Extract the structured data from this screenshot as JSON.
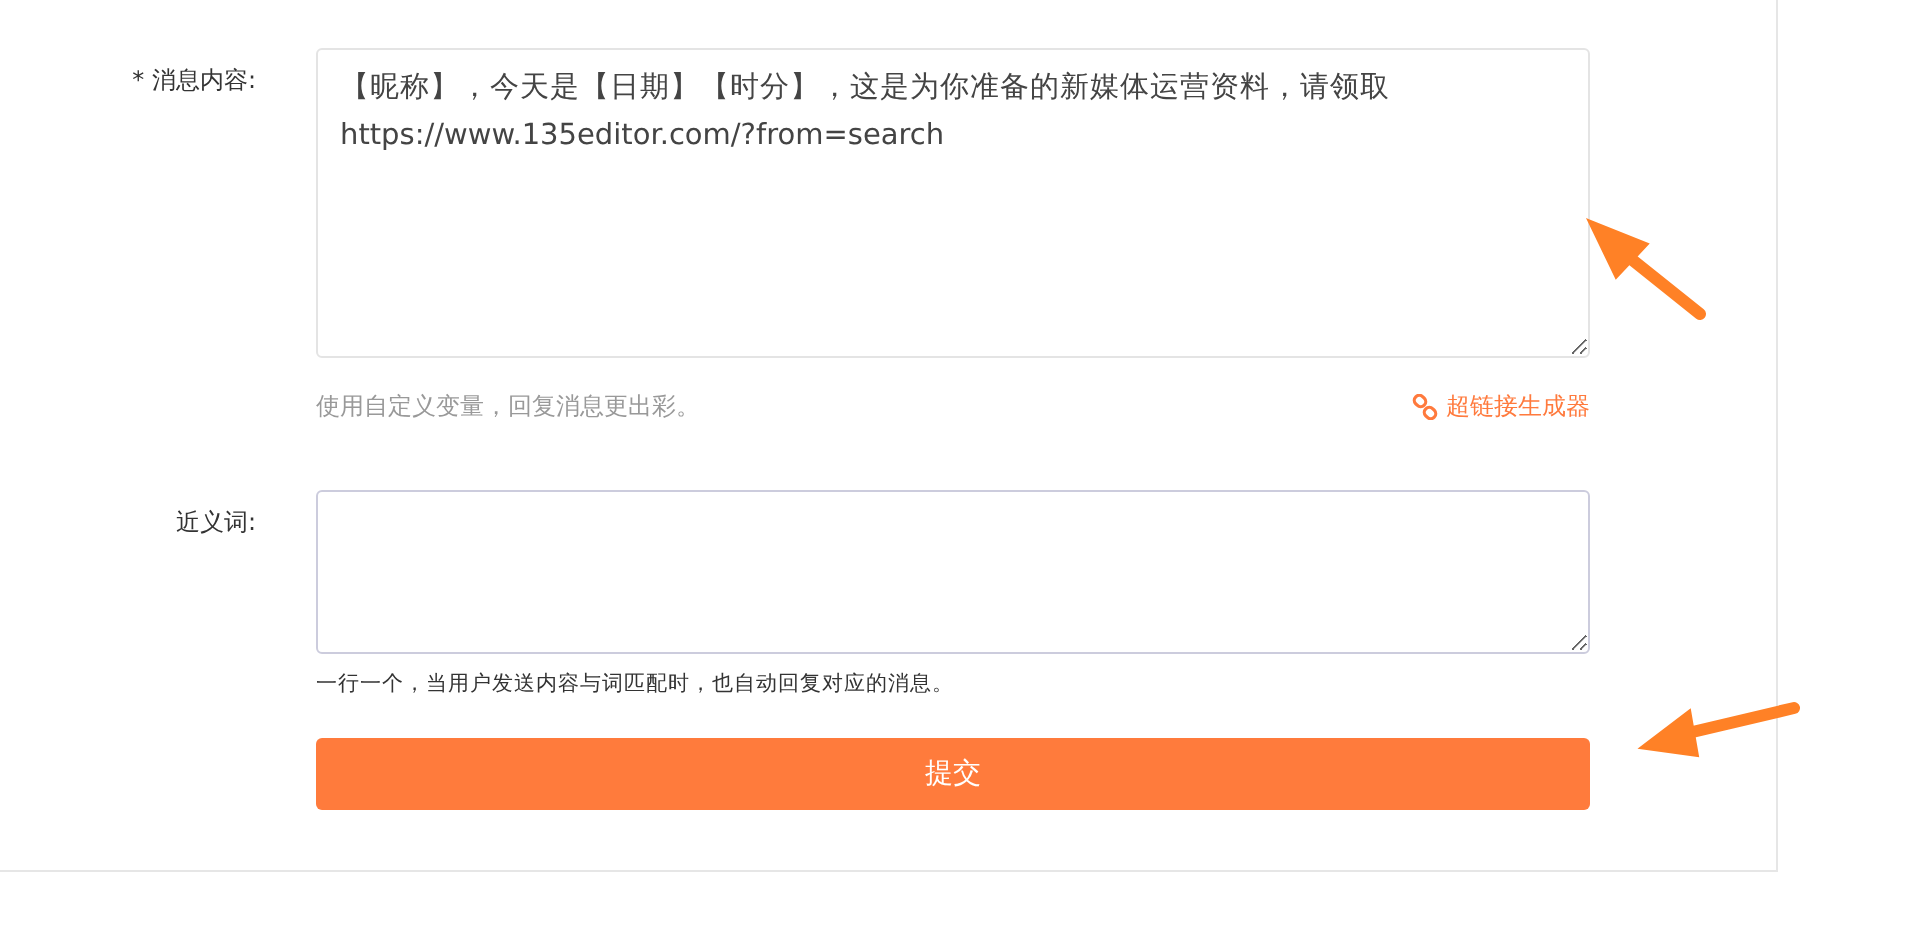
{
  "form": {
    "fields": [
      {
        "label": "* 消息内容:",
        "value": "【昵称】，今天是【日期】【时分】，这是为你准备的新媒体运营资料，请领取https://www.135editor.com/?from=search",
        "hint": "使用自定义变量，回复消息更出彩。",
        "link": "超链接生成器"
      },
      {
        "label": "近义词:",
        "hint": "一行一个，当用户发送内容与词匹配时，也自动回复对应的消息。"
      }
    ],
    "submit": "提交"
  }
}
